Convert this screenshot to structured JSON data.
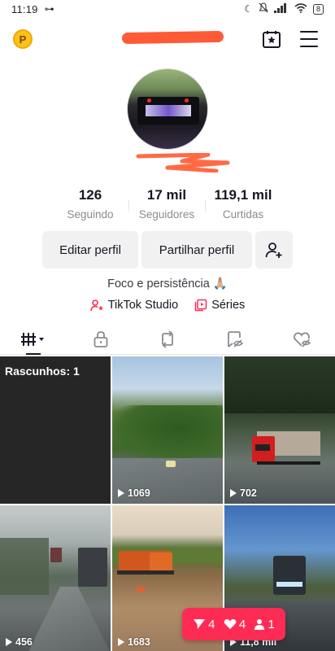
{
  "status_bar": {
    "time": "11:19",
    "battery": "8"
  },
  "header": {
    "coin_letter": "P"
  },
  "stats": [
    {
      "value": "126",
      "label": "Seguindo"
    },
    {
      "value": "17 mil",
      "label": "Seguidores"
    },
    {
      "value": "119,1 mil",
      "label": "Curtidas"
    }
  ],
  "buttons": {
    "edit": "Editar perfil",
    "share": "Partilhar perfil"
  },
  "bio": "Foco e persistência 🙏🏼",
  "links": {
    "studio": "TikTok Studio",
    "series": "Séries"
  },
  "grid": {
    "drafts_label": "Rascunhos: 1",
    "videos": [
      {
        "views": "1069"
      },
      {
        "views": "702"
      },
      {
        "views": "456"
      },
      {
        "views": "1683"
      },
      {
        "views": "11,8 mil"
      }
    ]
  },
  "notification": {
    "shares": "4",
    "likes": "4",
    "followers": "1"
  },
  "colors": {
    "accent": "#fe2c55",
    "coin": "#f9c21a",
    "redaction": "#ff5a36"
  }
}
